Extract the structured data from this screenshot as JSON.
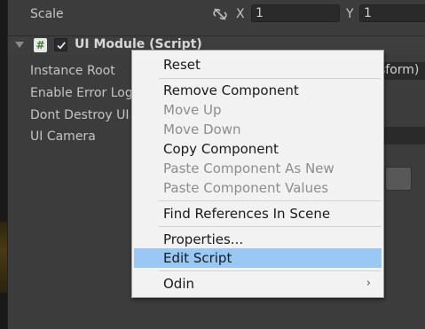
{
  "transform": {
    "scale_label": "Scale",
    "x_axis": "X",
    "x_value": "1",
    "y_axis": "Y",
    "y_value": "1"
  },
  "component": {
    "title": "UI Module (Script)",
    "enabled": true,
    "fields": [
      {
        "label": "Instance Root",
        "value": "sform)"
      },
      {
        "label": "Enable Error Log"
      },
      {
        "label": "Dont Destroy UI"
      },
      {
        "label": "UI Camera"
      }
    ]
  },
  "context_menu": {
    "items": [
      {
        "label": "Reset",
        "enabled": true
      },
      {
        "label": "Remove Component",
        "enabled": true
      },
      {
        "label": "Move Up",
        "enabled": false
      },
      {
        "label": "Move Down",
        "enabled": false
      },
      {
        "label": "Copy Component",
        "enabled": true
      },
      {
        "label": "Paste Component As New",
        "enabled": false
      },
      {
        "label": "Paste Component Values",
        "enabled": false
      },
      {
        "label": "Find References In Scene",
        "enabled": true
      },
      {
        "label": "Properties...",
        "enabled": true
      },
      {
        "label": "Edit Script",
        "enabled": true,
        "highlighted": true
      },
      {
        "label": "Odin",
        "enabled": true,
        "submenu": true
      }
    ],
    "highlight_color": "#99c8f5"
  },
  "icons": {
    "link": "unlinked-chain-icon",
    "script": "#",
    "submenu": "›"
  }
}
